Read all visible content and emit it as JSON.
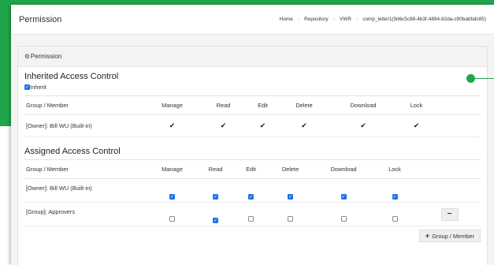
{
  "header": {
    "title": "Permission",
    "breadcrumb": [
      "Home",
      "Repository",
      "VWR",
      "comp_letter1(9d6c5c88-4b3f-4894-82da-c90babfafc85)"
    ]
  },
  "panel": {
    "title": "Permission"
  },
  "inherited": {
    "title": "Inherited Access Control",
    "inherit_label": "Inherit",
    "inherit_checked": true,
    "columns": [
      "Group / Member",
      "Manage",
      "Read",
      "Edit",
      "Delete",
      "Download",
      "Lock"
    ],
    "rows": [
      {
        "member": "[Owner]: Bill WU (Built-in)",
        "perms": [
          true,
          true,
          true,
          true,
          true,
          true
        ]
      }
    ]
  },
  "assigned": {
    "title": "Assigned Access Control",
    "columns": [
      "Group / Member",
      "Manage",
      "Read",
      "Edit",
      "Delete",
      "Download",
      "Lock"
    ],
    "rows": [
      {
        "member": "[Owner]: Bill WU (Built-in)",
        "perms": [
          true,
          true,
          true,
          true,
          true,
          true
        ],
        "removable": false
      },
      {
        "member": "[Group]: Approvers",
        "perms": [
          false,
          true,
          false,
          false,
          false,
          false
        ],
        "removable": true
      }
    ],
    "add_label": "Group / Member"
  },
  "colors": {
    "accent": "#1fa64a",
    "checkbox": "#1a73e8"
  }
}
